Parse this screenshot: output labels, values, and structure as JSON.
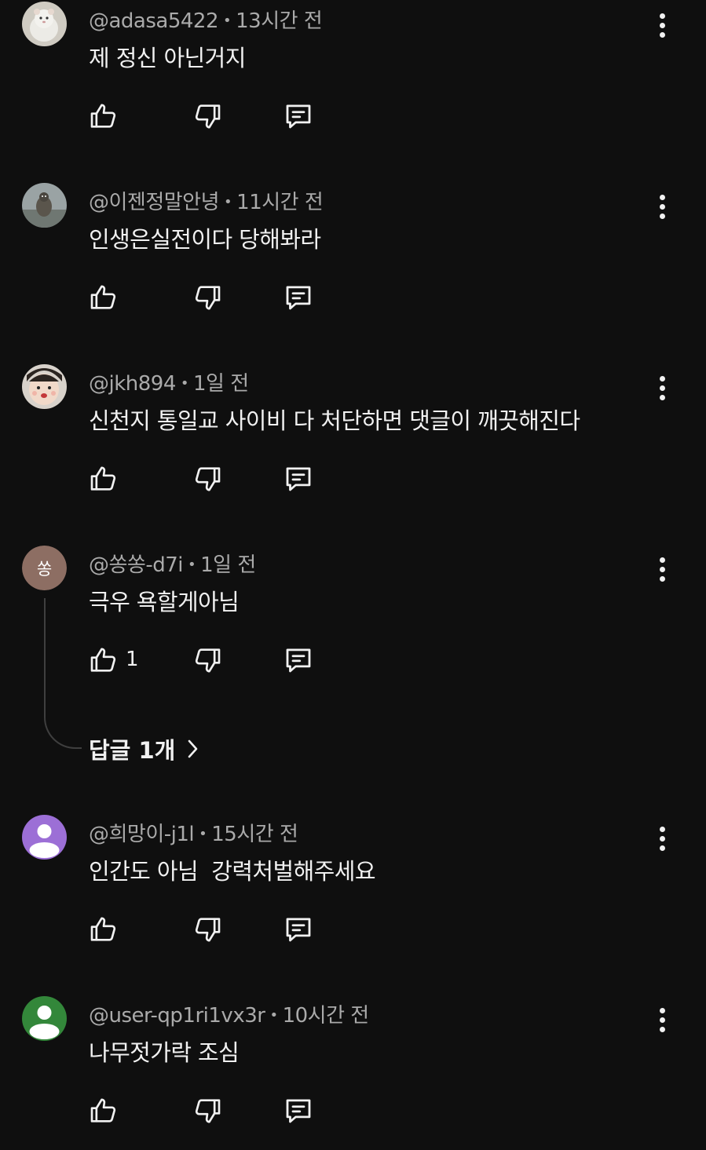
{
  "comments": [
    {
      "author": "@adasa5422",
      "time": "13시간 전",
      "text": "제 정신 아닌거지",
      "likes": "",
      "avatar": {
        "type": "image",
        "desc": "hamster-photo",
        "color": "#d9d6cf"
      }
    },
    {
      "author": "@이젠정말안녕",
      "time": "11시간 전",
      "text": "인생은실전이다 당해봐라",
      "likes": "",
      "avatar": {
        "type": "image",
        "desc": "animal-photo",
        "color": "#8f9a9c"
      }
    },
    {
      "author": "@jkh894",
      "time": "1일 전",
      "text": "신천지 통일교 사이비 다 처단하면 댓글이 깨끗해진다",
      "likes": "",
      "avatar": {
        "type": "image",
        "desc": "baby-photo",
        "color": "#e8d6c8"
      }
    },
    {
      "author": "@쏭쏭-d7i",
      "time": "1일 전",
      "text": "극우 욕할게아님",
      "likes": "1",
      "avatar": {
        "type": "letter",
        "letter": "쏭",
        "color": "#8d6e63"
      }
    },
    {
      "author": "@희망이-j1l",
      "time": "15시간 전",
      "text": "인간도 아님  강력처벌해주세요",
      "likes": "",
      "avatar": {
        "type": "default",
        "color": "#9c6fd6"
      }
    },
    {
      "author": "@user-qp1ri1vx3r",
      "time": "10시간 전",
      "text": "나무젓가락 조심",
      "likes": "",
      "avatar": {
        "type": "default",
        "color": "#33873a"
      }
    }
  ],
  "replies": {
    "label": "답글 1개"
  },
  "colors": {
    "background": "#0f0f0f",
    "text_primary": "#f1f1f1",
    "text_secondary": "#aaaaaa"
  },
  "icons": {
    "like": "thumbs-up-icon",
    "dislike": "thumbs-down-icon",
    "reply": "comment-reply-icon",
    "more": "more-vertical-icon",
    "chevron": "chevron-right-icon"
  }
}
